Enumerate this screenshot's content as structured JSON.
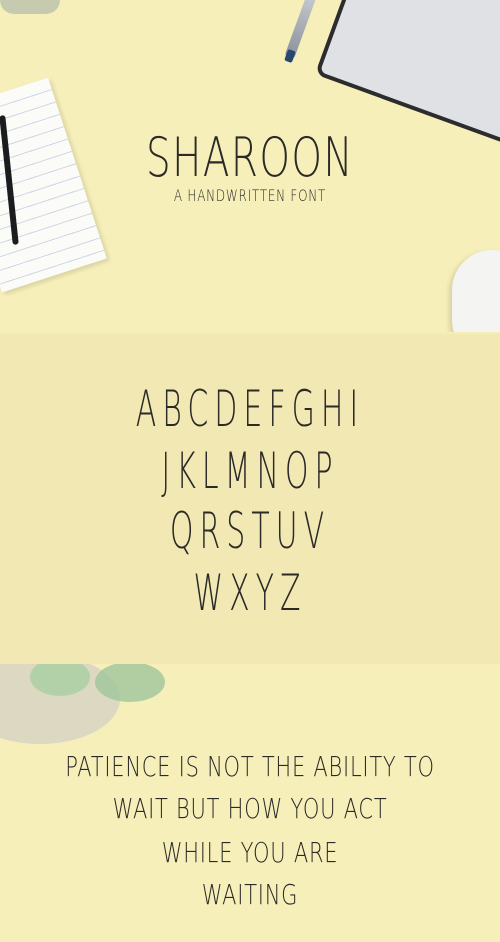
{
  "title": "SHAROON",
  "subtitle": "A HANDWRITTEN FONT",
  "alphabet": [
    "ABCDEFGHI",
    "JKLMNOP",
    "QRSTUV",
    "WXYZ"
  ],
  "quote": [
    "PATIENCE IS NOT THE ABILITY TO",
    "WAIT BUT HOW YOU ACT",
    "WHILE YOU ARE",
    "WAITING"
  ],
  "colors": {
    "background": "#f5edb6",
    "ink": "#2b2a27"
  }
}
